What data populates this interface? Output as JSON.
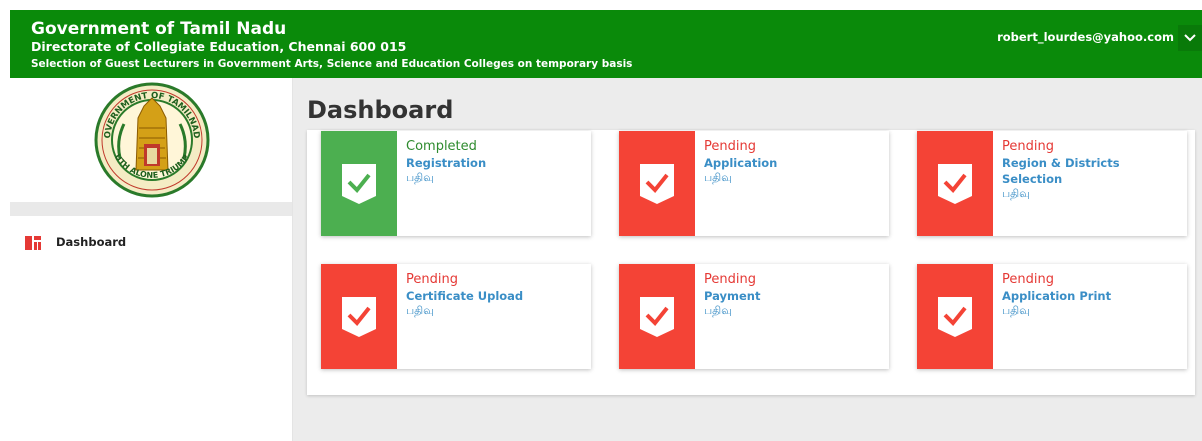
{
  "header": {
    "title": "Government of Tamil Nadu",
    "subtitle": "Directorate of Collegiate Education, Chennai 600 015",
    "subtitle2": "Selection of Guest Lecturers in Government Arts, Science and Education Colleges on temporary basis",
    "user_email": "robert_lourdes@yahoo.com",
    "user_menu_icon": "chevron-down-icon"
  },
  "logo": {
    "top_text": "GOVERNMENT OF TAMILNADU",
    "bottom_text": "TRUTH ALONE TRIUMPHS"
  },
  "sidebar": {
    "items": [
      {
        "label": "Dashboard",
        "icon": "dashboard-icon"
      }
    ]
  },
  "main": {
    "page_title": "Dashboard",
    "cards": [
      {
        "status": "Completed",
        "title_line1": "Registration",
        "title_line2": "",
        "subtitle": "பதிவு",
        "state": "completed",
        "color": "#4caf50"
      },
      {
        "status": "Pending",
        "title_line1": "Application",
        "title_line2": "",
        "subtitle": "பதிவு",
        "state": "pending",
        "color": "#f44336"
      },
      {
        "status": "Pending",
        "title_line1": "Region & Districts",
        "title_line2": "Selection",
        "subtitle": "பதிவு",
        "state": "pending",
        "color": "#f44336"
      },
      {
        "status": "Pending",
        "title_line1": "Certificate Upload",
        "title_line2": "",
        "subtitle": "பதிவு",
        "state": "pending",
        "color": "#f44336"
      },
      {
        "status": "Pending",
        "title_line1": "Payment",
        "title_line2": "",
        "subtitle": "பதிவு",
        "state": "pending",
        "color": "#f44336"
      },
      {
        "status": "Pending",
        "title_line1": "Application Print",
        "title_line2": "",
        "subtitle": "பதிவு",
        "state": "pending",
        "color": "#f44336"
      }
    ]
  },
  "colors": {
    "header_bg": "#0a8a0a",
    "completed": "#4caf50",
    "pending": "#f44336",
    "link": "#3a8ec6"
  }
}
